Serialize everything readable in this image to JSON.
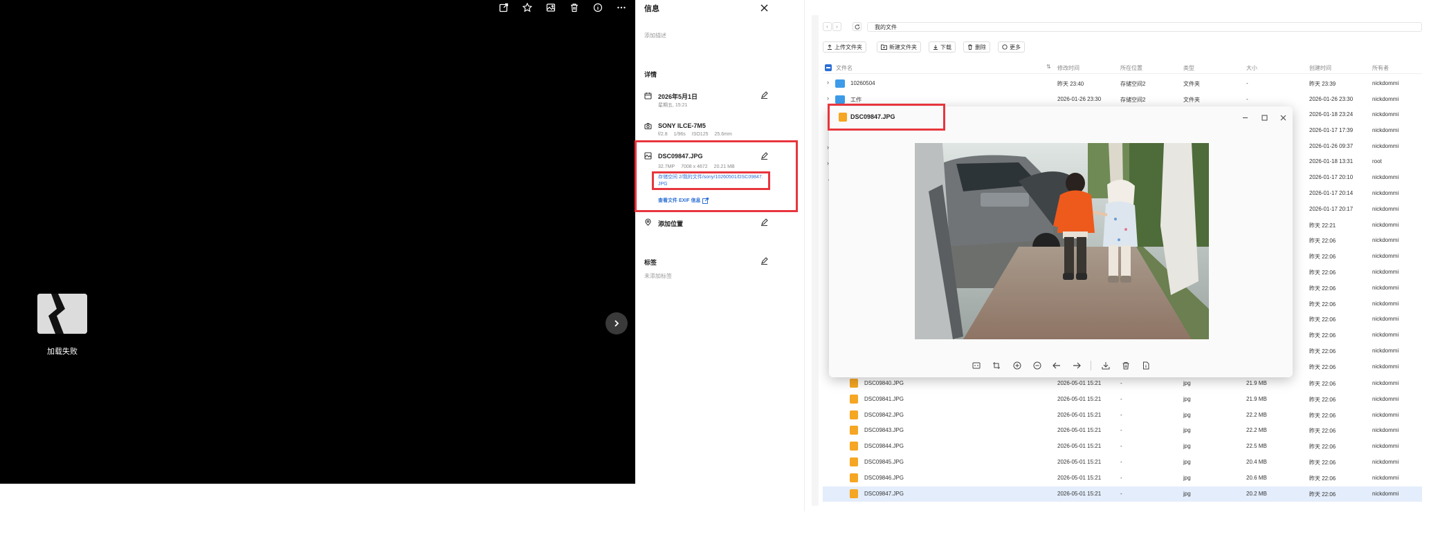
{
  "viewer": {
    "fail_text": "加载失败",
    "toolbar_icons": [
      "share-icon",
      "star-icon",
      "image-icon",
      "trash-icon",
      "info-icon",
      "more-icon"
    ]
  },
  "info": {
    "title": "信息",
    "add_desc": "添加描述",
    "details_heading": "详情",
    "date": "2026年5月1日",
    "date_sub": "星期五, 15:21",
    "camera": "SONY ILCE-7M5",
    "exif_f": "f/2.8",
    "exif_s": "1/96s",
    "exif_iso": "ISO125",
    "exif_mm": "25.6mm",
    "file_name": "DSC09847.JPG",
    "file_mp": "32.7MP",
    "file_dim": "7008 x 4672",
    "file_size": "20.21 MB",
    "file_path_1": "存储空间 2/我的文件/sony/10260501/DSC09847.",
    "file_path_2": "JPG",
    "exif_link": "查看文件 EXIF 信息",
    "add_location": "添加位置",
    "tags_heading": "标签",
    "no_tags": "未添加标签"
  },
  "fm": {
    "breadcrumb": "我的文件",
    "toolbar": {
      "upload": "上传文件夹",
      "new_folder": "新建文件夹",
      "download": "下载",
      "delete": "删除",
      "more": "更多"
    },
    "headers": {
      "name": "文件名",
      "modified": "修改时间",
      "location": "所在位置",
      "type": "类型",
      "size": "大小",
      "created": "创建时间",
      "owner": "所有者"
    },
    "rows": [
      {
        "name": "10260504",
        "modified": "昨天 23:40",
        "location": "存储空间2",
        "type": "文件夹",
        "size": "-",
        "created": "昨天 23:39",
        "owner": "nickdommi"
      },
      {
        "name": "工作",
        "modified": "2026-01-26 23:30",
        "location": "存储空间2",
        "type": "文件夹",
        "size": "-",
        "created": "2026-01-26 23:30",
        "owner": "nickdommi"
      }
    ],
    "bg_rows": [
      {
        "created": "2026-01-18 23:24",
        "owner": "nickdommi"
      },
      {
        "created": "2026-01-17 17:39",
        "owner": "nickdommi"
      },
      {
        "created": "2026-01-26 09:37",
        "owner": "nickdommi"
      },
      {
        "created": "2026-01-18 13:31",
        "owner": "root"
      },
      {
        "created": "2026-01-17 20:10",
        "owner": "nickdommi"
      },
      {
        "created": "2026-01-17 20:14",
        "owner": "nickdommi"
      },
      {
        "created": "2026-01-17 20:17",
        "owner": "nickdommi"
      },
      {
        "created": "昨天 22:21",
        "owner": "nickdommi"
      },
      {
        "created": "昨天 22:06",
        "owner": "nickdommi"
      },
      {
        "created": "昨天 22:06",
        "owner": "nickdommi"
      },
      {
        "created": "昨天 22:06",
        "owner": "nickdommi"
      },
      {
        "created": "昨天 22:06",
        "owner": "nickdommi"
      },
      {
        "created": "昨天 22:06",
        "owner": "nickdommi"
      },
      {
        "created": "昨天 22:06",
        "owner": "nickdommi"
      },
      {
        "created": "昨天 22:06",
        "owner": "nickdommi"
      },
      {
        "created": "昨天 22:06",
        "owner": "nickdommi"
      },
      {
        "created": "昨天 22:06",
        "owner": "nickdommi"
      }
    ],
    "files": [
      {
        "name": "DSC09840.JPG",
        "modified": "2026-05-01 15:21",
        "location": "-",
        "type": "jpg",
        "size": "21.9 MB",
        "created": "昨天 22:06",
        "owner": "nickdommi"
      },
      {
        "name": "DSC09841.JPG",
        "modified": "2026-05-01 15:21",
        "location": "-",
        "type": "jpg",
        "size": "21.9 MB",
        "created": "昨天 22:06",
        "owner": "nickdommi"
      },
      {
        "name": "DSC09842.JPG",
        "modified": "2026-05-01 15:21",
        "location": "-",
        "type": "jpg",
        "size": "22.2 MB",
        "created": "昨天 22:06",
        "owner": "nickdommi"
      },
      {
        "name": "DSC09843.JPG",
        "modified": "2026-05-01 15:21",
        "location": "-",
        "type": "jpg",
        "size": "22.2 MB",
        "created": "昨天 22:06",
        "owner": "nickdommi"
      },
      {
        "name": "DSC09844.JPG",
        "modified": "2026-05-01 15:21",
        "location": "-",
        "type": "jpg",
        "size": "22.5 MB",
        "created": "昨天 22:06",
        "owner": "nickdommi"
      },
      {
        "name": "DSC09845.JPG",
        "modified": "2026-05-01 15:21",
        "location": "-",
        "type": "jpg",
        "size": "20.4 MB",
        "created": "昨天 22:06",
        "owner": "nickdommi"
      },
      {
        "name": "DSC09846.JPG",
        "modified": "2026-05-01 15:21",
        "location": "-",
        "type": "jpg",
        "size": "20.6 MB",
        "created": "昨天 22:06",
        "owner": "nickdommi"
      },
      {
        "name": "DSC09847.JPG",
        "modified": "2026-05-01 15:21",
        "location": "-",
        "type": "jpg",
        "size": "20.2 MB",
        "created": "昨天 22:06",
        "owner": "nickdommi"
      }
    ]
  },
  "popup": {
    "title": "DSC09847.JPG"
  },
  "colors": {
    "accent": "#2c6fd6",
    "highlight": "#e8353d",
    "selected_row": "#e3edfb"
  }
}
